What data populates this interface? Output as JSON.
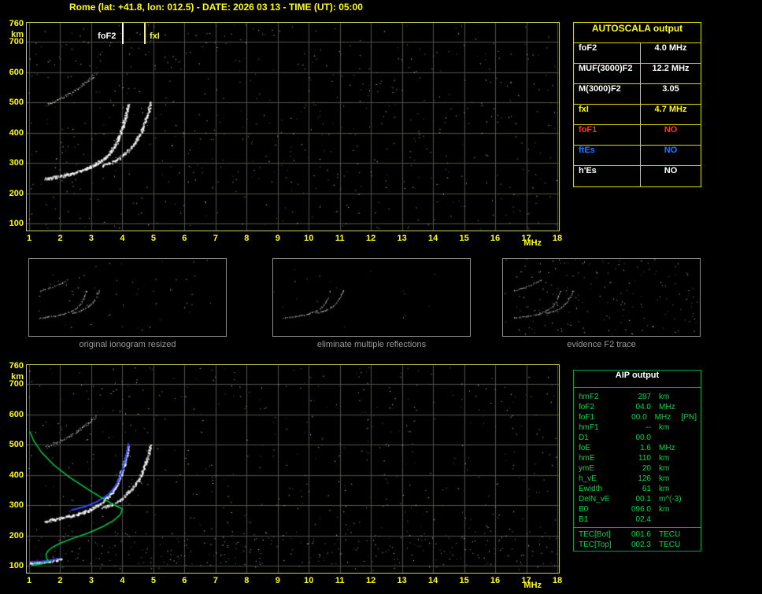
{
  "title": "Rome (lat: +41.8, lon: 012.5) - DATE: 2026 03 13 - TIME (UT): 05:00",
  "colors": {
    "background": "#000000",
    "plot_border": "#c9c955",
    "axis_text": "#ffff00",
    "grid": "#50504b",
    "trace": "#ffffff",
    "profile": "#00cc44",
    "restored": "#2946ff",
    "caption": "#9a9a9a",
    "autoscala_border": "#d9d900",
    "aip_border": "#00a344",
    "aip_text": "#00d24e",
    "red": "#ff3030",
    "blue": "#1e78ff",
    "white": "#ffffff",
    "yellow": "#ffff00"
  },
  "top_plot": {
    "y_unit": "km",
    "x_unit": "MHz",
    "y_ticks": [
      "760",
      "700",
      "600",
      "500",
      "400",
      "300",
      "200",
      "100"
    ],
    "x_ticks": [
      "1",
      "2",
      "3",
      "4",
      "5",
      "6",
      "7",
      "8",
      "9",
      "10",
      "11",
      "12",
      "13",
      "14",
      "15",
      "16",
      "17",
      "18"
    ],
    "foF2_marker": {
      "label": "foF2",
      "freq": 4.0,
      "color": "#ffffff"
    },
    "fxI_marker": {
      "label": "fxI",
      "freq": 4.7,
      "color": "#ffff00"
    }
  },
  "bottom_plot": {
    "y_unit": "km",
    "x_unit": "MHz",
    "y_ticks": [
      "760",
      "700",
      "600",
      "500",
      "400",
      "300",
      "200",
      "100"
    ],
    "x_ticks": [
      "1",
      "2",
      "3",
      "4",
      "5",
      "6",
      "7",
      "8",
      "9",
      "10",
      "11",
      "12",
      "13",
      "14",
      "15",
      "16",
      "17",
      "18"
    ]
  },
  "autoscala": {
    "header": "AUTOSCALA output",
    "rows": [
      {
        "label": "foF2",
        "value": "4.0 MHz",
        "color": "#ffffff"
      },
      {
        "label": "MUF(3000)F2",
        "value": "12.2 MHz",
        "color": "#ffffff"
      },
      {
        "label": "M(3000)F2",
        "value": "3.05",
        "color": "#ffffff"
      },
      {
        "label": "fxI",
        "value": "4.7 MHz",
        "color": "#ffff00"
      },
      {
        "label": "foF1",
        "value": "NO",
        "color": "#ff3030"
      },
      {
        "label": "ftEs",
        "value": "NO",
        "color": "#1e78ff"
      },
      {
        "label": "h'Es",
        "value": "NO",
        "color": "#ffffff"
      }
    ]
  },
  "thumbnails": [
    {
      "caption": "original ionogram resized"
    },
    {
      "caption": "eliminate multiple reflections"
    },
    {
      "caption": "evidence F2 trace"
    }
  ],
  "aip": {
    "header": "AIP output",
    "rows": [
      {
        "label": "hmF2",
        "value": "287",
        "unit": "km",
        "note": ""
      },
      {
        "label": "foF2",
        "value": "04.0",
        "unit": "MHz",
        "note": ""
      },
      {
        "label": "foF1",
        "value": "00.0",
        "unit": "MHz",
        "note": "[PN]"
      },
      {
        "label": "hmF1",
        "value": "--",
        "unit": "km",
        "note": ""
      },
      {
        "label": "D1",
        "value": "00.0",
        "unit": "",
        "note": ""
      },
      {
        "label": "foE",
        "value": "1.6",
        "unit": "MHz",
        "note": ""
      },
      {
        "label": "hmE",
        "value": "110",
        "unit": "km",
        "note": ""
      },
      {
        "label": "ymE",
        "value": "20",
        "unit": "km",
        "note": ""
      },
      {
        "label": "h_vE",
        "value": "126",
        "unit": "km",
        "note": ""
      },
      {
        "label": "Ewidth",
        "value": "61",
        "unit": "km",
        "note": ""
      },
      {
        "label": "DelN_vE",
        "value": "00.1",
        "unit": "m^(-3)",
        "note": ""
      },
      {
        "label": "B0",
        "value": "096.0",
        "unit": "km",
        "note": ""
      },
      {
        "label": "B1",
        "value": "02.4",
        "unit": "",
        "note": ""
      }
    ],
    "tec_rows": [
      {
        "label": "TEC[Bot]",
        "value": "001.6",
        "unit": "TECU"
      },
      {
        "label": "TEC[Top]",
        "value": "002.3",
        "unit": "TECU"
      }
    ]
  },
  "chart_data": [
    {
      "id": "autoscala_ionogram",
      "type": "scatter",
      "title": "scaled ionogram with foF2 and fxI markers",
      "xlabel": "MHz",
      "ylabel": "km",
      "xlim": [
        1,
        18
      ],
      "ylim": [
        100,
        760
      ],
      "grid": true,
      "markers": [
        {
          "name": "foF2",
          "x_MHz": 4.0
        },
        {
          "name": "fxI",
          "x_MHz": 4.7
        }
      ],
      "series": [
        {
          "name": "F2 trace o-mode",
          "points": [
            [
              1.5,
              248
            ],
            [
              1.8,
              254
            ],
            [
              2.1,
              260
            ],
            [
              2.45,
              268
            ],
            [
              2.8,
              280
            ],
            [
              3.1,
              295
            ],
            [
              3.4,
              315
            ],
            [
              3.65,
              342
            ],
            [
              3.85,
              378
            ],
            [
              4.0,
              420
            ],
            [
              4.1,
              462
            ],
            [
              4.18,
              500
            ]
          ]
        },
        {
          "name": "F2 trace x-mode",
          "points": [
            [
              3.35,
              292
            ],
            [
              3.7,
              305
            ],
            [
              4.0,
              325
            ],
            [
              4.3,
              355
            ],
            [
              4.55,
              392
            ],
            [
              4.7,
              430
            ],
            [
              4.82,
              468
            ],
            [
              4.9,
              505
            ]
          ]
        },
        {
          "name": "F2 second hop",
          "points": [
            [
              1.55,
              492
            ],
            [
              1.9,
              508
            ],
            [
              2.25,
              526
            ],
            [
              2.6,
              548
            ],
            [
              2.9,
              572
            ],
            [
              3.15,
              595
            ]
          ]
        }
      ]
    },
    {
      "id": "aip_profile_ionogram",
      "type": "line",
      "title": "ionogram with restored trace and electron density profile",
      "xlabel": "MHz",
      "ylabel": "km",
      "xlim": [
        1,
        18
      ],
      "ylim": [
        100,
        760
      ],
      "grid": true,
      "series": [
        {
          "name": "electron density profile",
          "color_key": "profile",
          "points": [
            [
              1.02,
              543
            ],
            [
              1.15,
              512
            ],
            [
              1.4,
              474
            ],
            [
              1.8,
              432
            ],
            [
              2.3,
              392
            ],
            [
              2.85,
              355
            ],
            [
              3.35,
              323
            ],
            [
              3.75,
              300
            ],
            [
              3.97,
              289
            ],
            [
              4.0,
              287
            ],
            [
              3.93,
              268
            ],
            [
              3.7,
              248
            ],
            [
              3.35,
              228
            ],
            [
              2.9,
              208
            ],
            [
              2.4,
              190
            ],
            [
              2.0,
              174
            ],
            [
              1.75,
              161
            ],
            [
              1.6,
              148
            ],
            [
              1.54,
              136
            ],
            [
              1.56,
              126
            ],
            [
              1.62,
              115
            ],
            [
              1.6,
              110
            ],
            [
              1.35,
              105
            ],
            [
              1.08,
              101
            ]
          ]
        },
        {
          "name": "restored F2 trace",
          "color_key": "restored",
          "points": [
            [
              2.35,
              283
            ],
            [
              2.8,
              295
            ],
            [
              3.2,
              312
            ],
            [
              3.55,
              335
            ],
            [
              3.8,
              365
            ],
            [
              3.95,
              400
            ],
            [
              4.08,
              445
            ],
            [
              4.16,
              482
            ],
            [
              4.2,
              505
            ]
          ]
        },
        {
          "name": "restored E trace",
          "color_key": "restored",
          "points": [
            [
              1.02,
              113
            ],
            [
              1.4,
              114
            ],
            [
              1.7,
              118
            ],
            [
              1.95,
              124
            ]
          ]
        },
        {
          "name": "E region echoes",
          "color_key": "trace",
          "points": [
            [
              1.05,
              110
            ],
            [
              1.4,
              112
            ],
            [
              1.75,
              117
            ],
            [
              2.05,
              124
            ]
          ]
        }
      ],
      "parameters": {
        "hmF2_km": 287,
        "foF2_MHz": 4.0,
        "foF1_MHz": 0.0,
        "D1": 0.0,
        "foE_MHz": 1.6,
        "hmE_km": 110,
        "ymE_km": 20,
        "h_vE_km": 126,
        "Ewidth_km": 61,
        "DelN_vE_m-3": 0.1,
        "B0_km": 96.0,
        "B1": 2.4,
        "TEC_bot_TECU": 1.6,
        "TEC_top_TECU": 2.3
      }
    }
  ]
}
